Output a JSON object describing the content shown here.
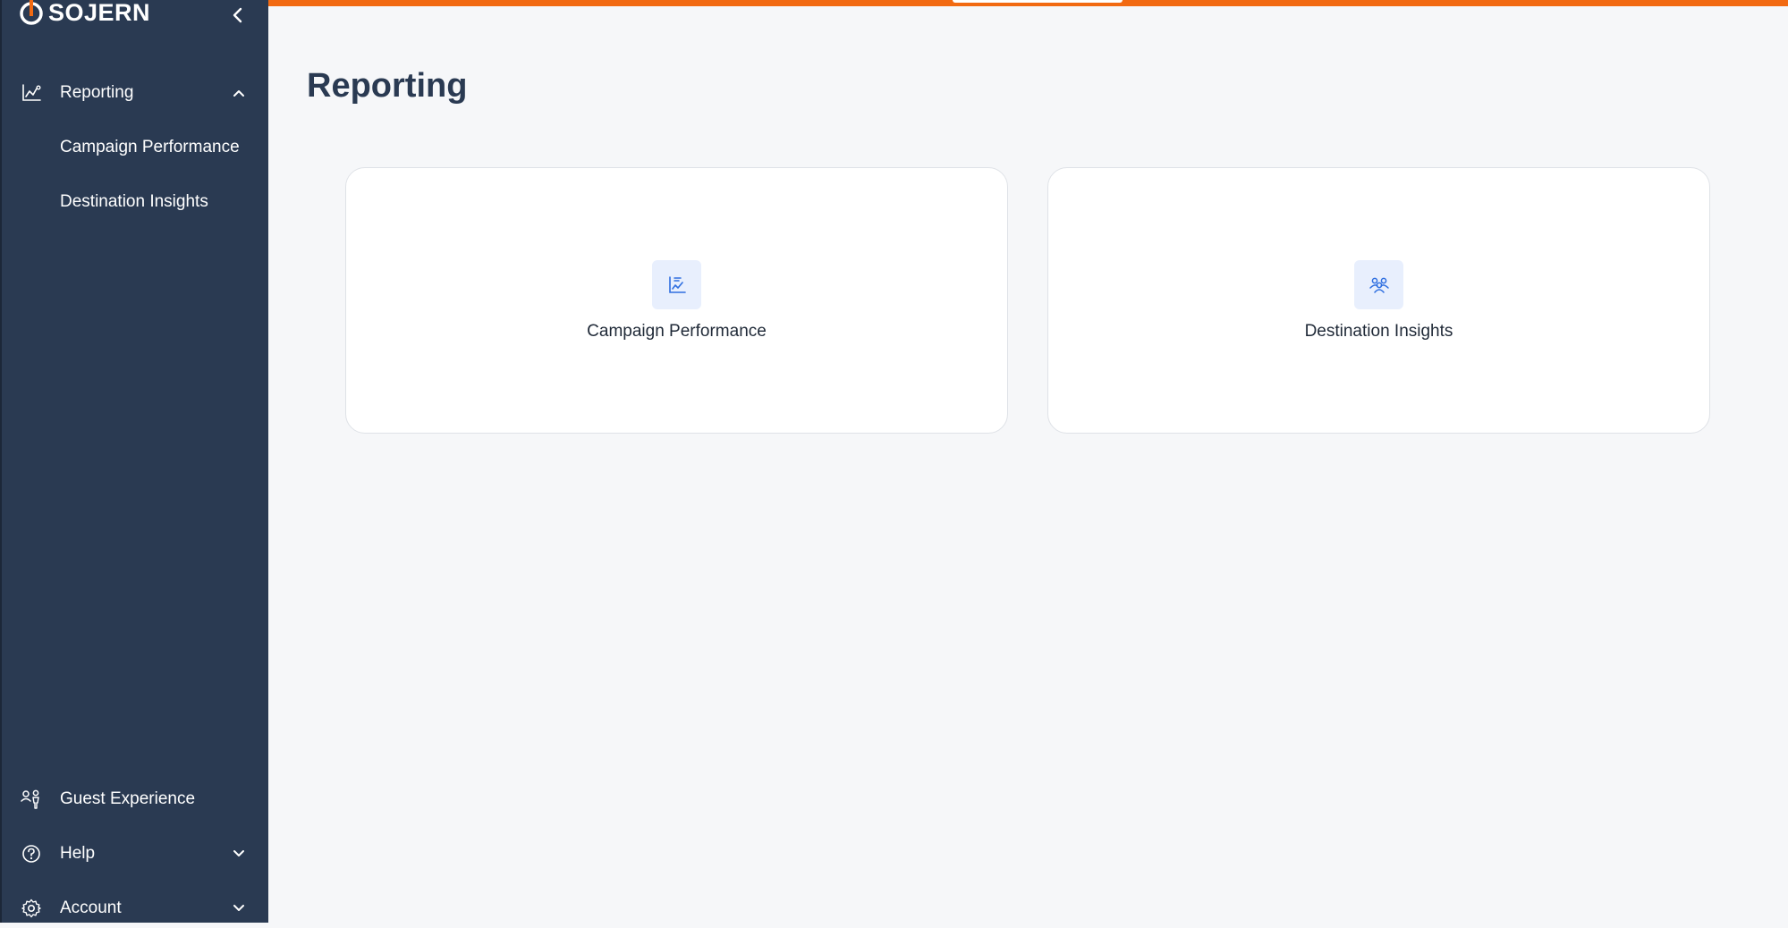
{
  "brand": {
    "name": "SOJERN",
    "accent_color": "#f26a12",
    "sidebar_color": "#2a3a52",
    "icon_blue": "#2f6fe0"
  },
  "sidebar": {
    "collapse_icon": "chevron-left-icon",
    "items": [
      {
        "label": "Reporting",
        "icon": "line-chart-icon",
        "expanded": true,
        "children": [
          {
            "label": "Campaign Performance"
          },
          {
            "label": "Destination Insights"
          }
        ]
      },
      {
        "label": "Guest Experience",
        "icon": "guest-experience-icon"
      },
      {
        "label": "Help",
        "icon": "help-circle-icon",
        "expanded": false
      },
      {
        "label": "Account",
        "icon": "gear-icon",
        "expanded": false
      }
    ]
  },
  "main": {
    "title": "Reporting",
    "cards": [
      {
        "label": "Campaign Performance",
        "icon": "campaign-chart-icon"
      },
      {
        "label": "Destination Insights",
        "icon": "people-group-icon"
      }
    ]
  }
}
